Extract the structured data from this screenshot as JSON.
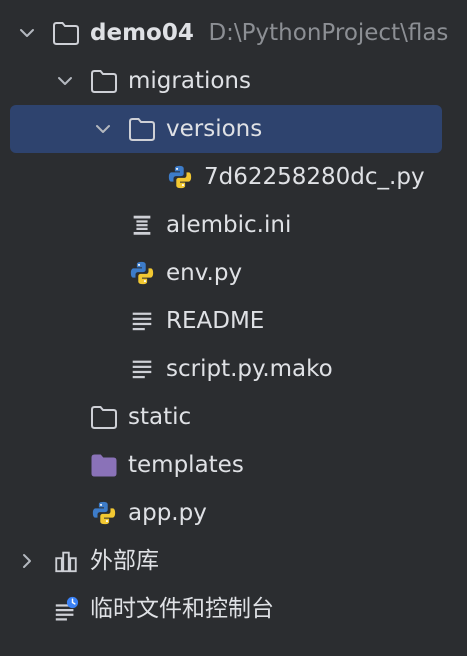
{
  "tree": {
    "root": {
      "name": "demo04",
      "path": "D:\\PythonProject\\flas"
    },
    "migrations": "migrations",
    "versions": "versions",
    "version_file": "7d62258280dc_.py",
    "alembic_ini": "alembic.ini",
    "env_py": "env.py",
    "readme": "README",
    "script_mako": "script.py.mako",
    "static": "static",
    "templates": "templates",
    "app_py": "app.py",
    "external_libraries": "外部库",
    "scratches": "临时文件和控制台"
  },
  "colors": {
    "background": "#2b2d30",
    "selection": "#2e436e",
    "text": "#dfe1e5",
    "muted": "#8c8f94",
    "templates_folder": "#8a72b8"
  },
  "icons": {
    "expanded": "chevron-down-icon",
    "collapsed": "chevron-right-icon",
    "folder": "folder-icon",
    "python_file": "python-file-icon",
    "ini_file": "ini-file-icon",
    "text_file": "text-file-icon",
    "library": "library-icon",
    "scratches": "scratches-icon"
  }
}
